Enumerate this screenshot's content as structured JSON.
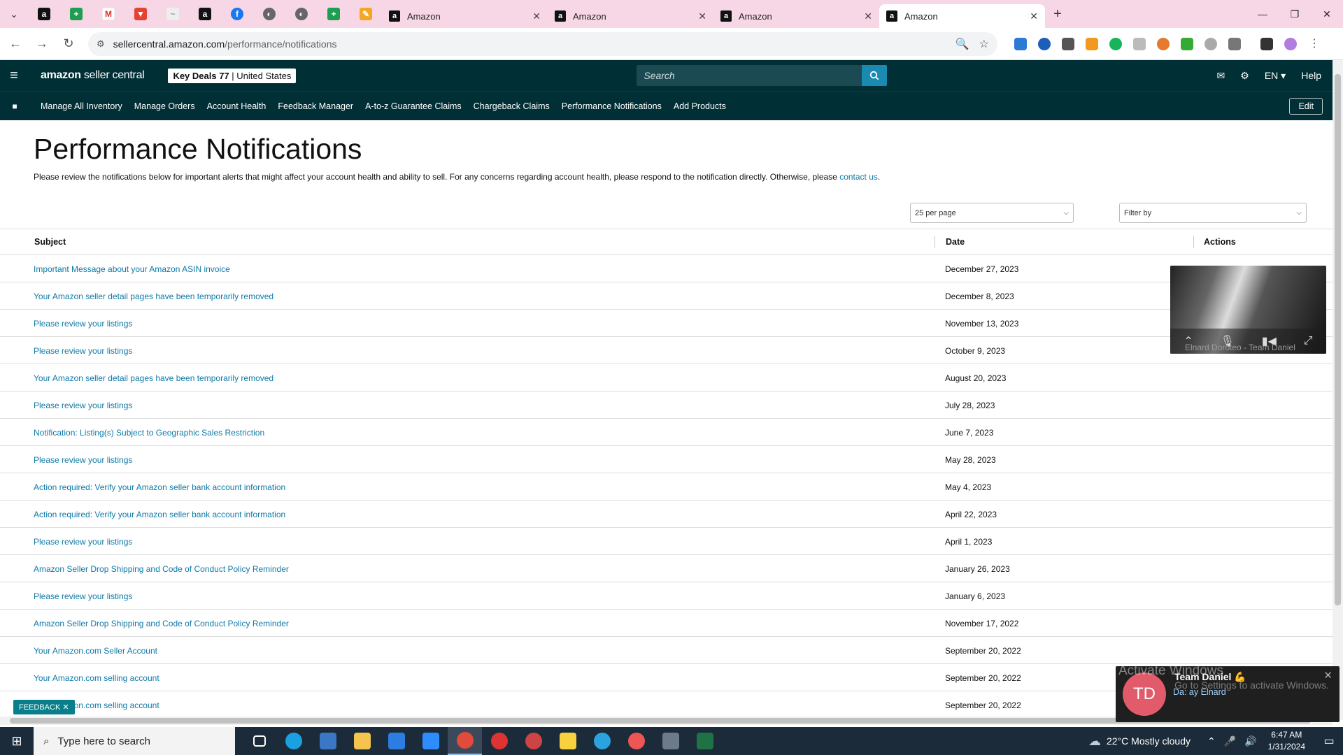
{
  "browser": {
    "tabs": [
      {
        "title": "Amazon",
        "active": false
      },
      {
        "title": "Amazon",
        "active": false
      },
      {
        "title": "Amazon",
        "active": false
      },
      {
        "title": "Amazon",
        "active": true
      }
    ],
    "url_host": "sellercentral.amazon.com",
    "url_path": "/performance/notifications"
  },
  "header": {
    "logo_main": "amazon",
    "logo_sub": " seller central",
    "store_name": "Key Deals 77",
    "store_region": "| United States",
    "search_placeholder": "Search",
    "language": "EN ▾",
    "help": "Help"
  },
  "nav": {
    "links": [
      "Manage All Inventory",
      "Manage Orders",
      "Account Health",
      "Feedback Manager",
      "A-to-z Guarantee Claims",
      "Chargeback Claims",
      "Performance Notifications",
      "Add Products"
    ],
    "edit": "Edit"
  },
  "main": {
    "title": "Performance Notifications",
    "intro": "Please review the notifications below for important alerts that might affect your account health and ability to sell. For any concerns regarding account health, please respond to the notification directly. Otherwise, please ",
    "intro_link": "contact us",
    "intro_end": ".",
    "per_page": "25 per page",
    "filter_placeholder": "Filter by",
    "columns": {
      "subject": "Subject",
      "date": "Date",
      "actions": "Actions"
    },
    "rows": [
      {
        "subject": "Important Message about your Amazon ASIN invoice",
        "date": "December 27, 2023"
      },
      {
        "subject": "Your Amazon seller detail pages have been temporarily removed",
        "date": "December 8, 2023"
      },
      {
        "subject": "Please review your listings",
        "date": "November 13, 2023"
      },
      {
        "subject": "Please review your listings",
        "date": "October 9, 2023"
      },
      {
        "subject": "Your Amazon seller detail pages have been temporarily removed",
        "date": "August 20, 2023"
      },
      {
        "subject": "Please review your listings",
        "date": "July 28, 2023"
      },
      {
        "subject": "Notification: Listing(s) Subject to Geographic Sales Restriction",
        "date": "June 7, 2023"
      },
      {
        "subject": "Please review your listings",
        "date": "May 28, 2023"
      },
      {
        "subject": "Action required: Verify your Amazon seller bank account information",
        "date": "May 4, 2023"
      },
      {
        "subject": "Action required: Verify your Amazon seller bank account information",
        "date": "April 22, 2023"
      },
      {
        "subject": "Please review your listings",
        "date": "April 1, 2023"
      },
      {
        "subject": "Amazon Seller Drop Shipping and Code of Conduct Policy Reminder",
        "date": "January 26, 2023"
      },
      {
        "subject": "Please review your listings",
        "date": "January 6, 2023"
      },
      {
        "subject": "Amazon Seller Drop Shipping and Code of Conduct Policy Reminder",
        "date": "November 17, 2022"
      },
      {
        "subject": "Your Amazon.com Seller Account",
        "date": "September 20, 2022"
      },
      {
        "subject": "Your Amazon.com selling account",
        "date": "September 20, 2022"
      },
      {
        "subject": "Your Amazon.com selling account",
        "date": "September 20, 2022"
      }
    ],
    "feedback": "FEEDBACK ✕"
  },
  "video": {
    "participant": "Elnard Doroteo - Team Daniel"
  },
  "toast": {
    "watermark1": "Activate Windows",
    "watermark2": "Go to Settings to activate Windows.",
    "avatar": "TD",
    "title": "Team Daniel 💪",
    "message": "Da: ay Elnard"
  },
  "taskbar": {
    "search_placeholder": "Type here to search",
    "weather": "22°C  Mostly cloudy",
    "time": "6:47 AM",
    "date": "1/31/2024"
  },
  "colors": {
    "amazon_header": "#002f36",
    "link": "#0f7aa8",
    "search_button": "#1b8ab1",
    "tab_strip": "#f7d7e6"
  }
}
